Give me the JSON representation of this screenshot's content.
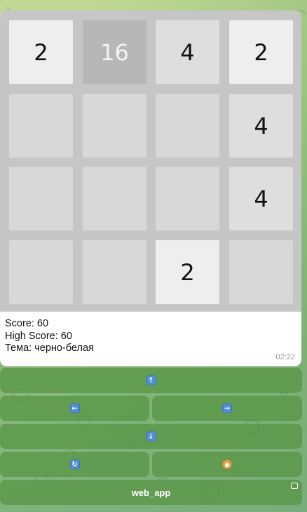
{
  "board": {
    "tiles": [
      [
        "2",
        "16",
        "4",
        "2"
      ],
      [
        "",
        "",
        "",
        "4"
      ],
      [
        "",
        "",
        "",
        "4"
      ],
      [
        "",
        "",
        "2",
        ""
      ]
    ]
  },
  "caption": {
    "score": "Score: 60",
    "high_score": "High Score: 60",
    "theme": "Тема: черно-белая"
  },
  "time": "02:22",
  "keyboard": {
    "up_icon": "arrow-up-icon",
    "left_icon": "arrow-left-icon",
    "right_icon": "arrow-right-icon",
    "down_icon": "arrow-down-icon",
    "restart_icon": "restart-icon",
    "theme_icon": "palette-icon",
    "web_app_label": "web_app"
  },
  "colors": {
    "board_bg": "#c6c6c6",
    "empty_tile": "#d8d8d8",
    "tile_2": "#eeeeee",
    "tile_4": "#dedede",
    "tile_16": "#b7b7b7",
    "button_bg": "#5a9646"
  }
}
